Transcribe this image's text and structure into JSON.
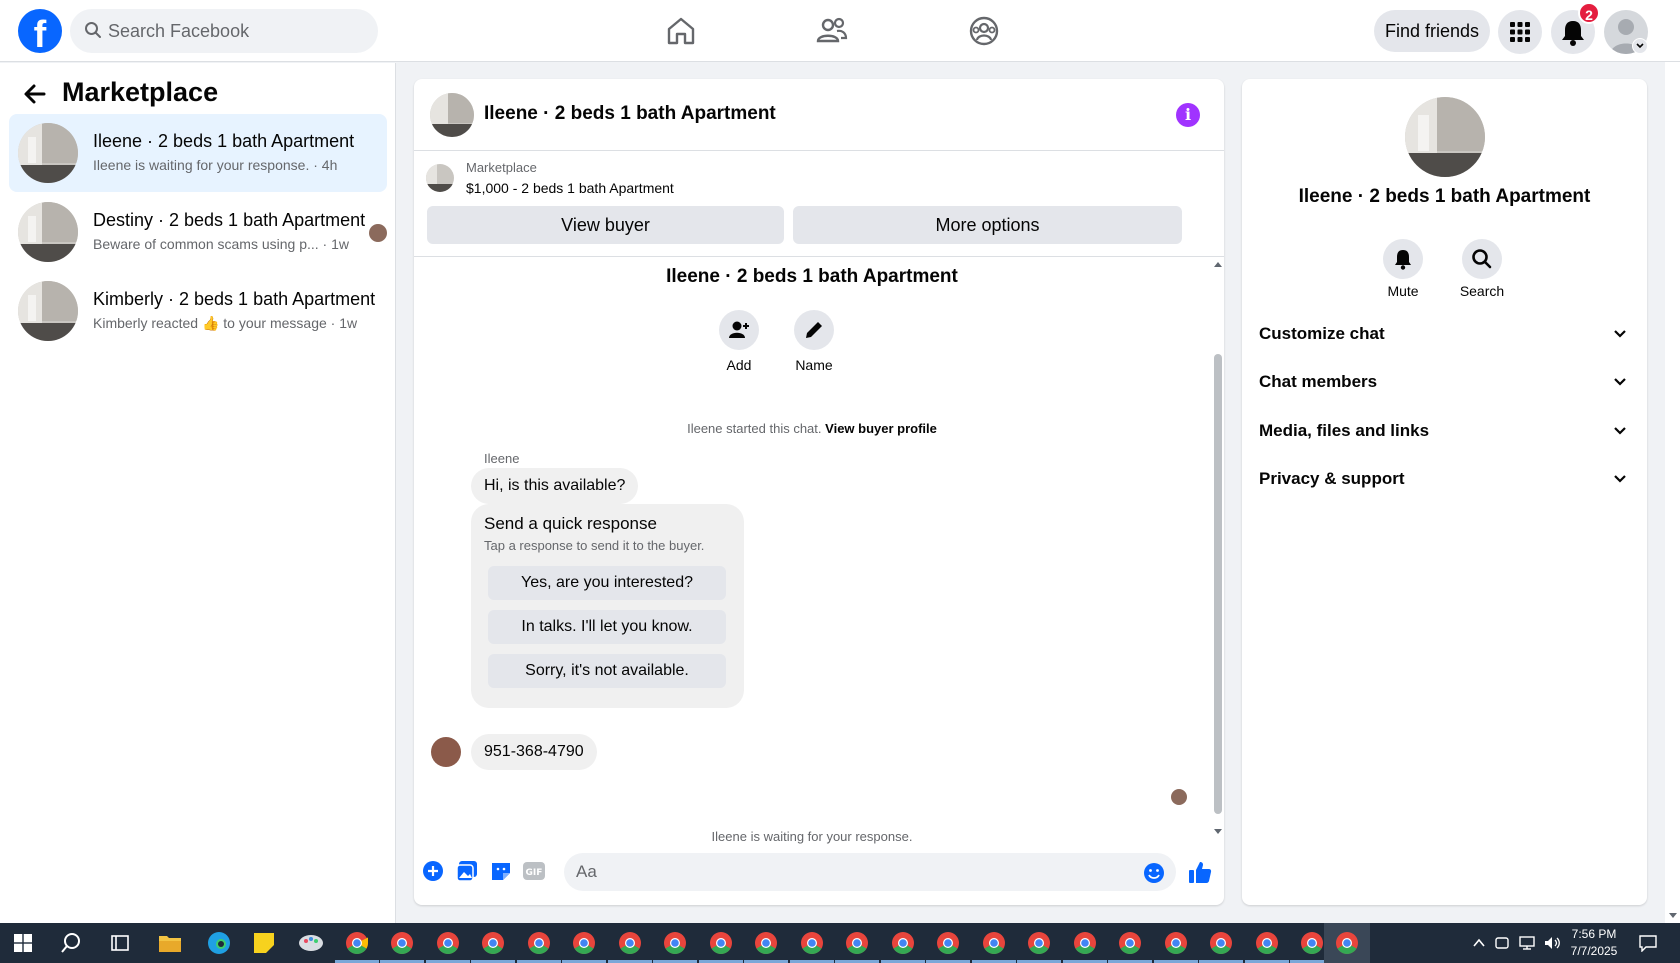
{
  "header": {
    "search_placeholder": "Search Facebook",
    "find_friends_label": "Find friends",
    "notification_count": "2"
  },
  "sidebar": {
    "title": "Marketplace",
    "conversations": [
      {
        "title": "Ileene · 2 beds 1 bath Apartment",
        "subtitle": "Ileene is waiting for your response. · 4h",
        "active": true
      },
      {
        "title": "Destiny · 2 beds 1 bath Apartment",
        "subtitle": "Beware of common scams using p... · 1w"
      },
      {
        "title": "Kimberly · 2 beds 1 bath Apartment",
        "subtitle_pre": "Kimberly reacted",
        "subtitle_emoji": "👍",
        "subtitle_post": "to your message · 1w"
      }
    ]
  },
  "chat": {
    "title": "Ileene · 2 beds 1 bath Apartment",
    "listing_category": "Marketplace",
    "listing_price": "$1,000 - 2 beds 1 bath Apartment",
    "view_buyer_label": "View buyer",
    "more_options_label": "More options",
    "conversation_title": "Ileene · 2 beds 1 bath Apartment",
    "add_label": "Add",
    "name_label": "Name",
    "started_text": "Ileene started this chat.",
    "view_profile_link": "View buyer profile",
    "sender_name": "Ileene",
    "first_message": "Hi, is this available?",
    "quick_title": "Send a quick response",
    "quick_subtitle": "Tap a response to send it to the buyer.",
    "quick_options": [
      "Yes, are you interested?",
      "In talks. I'll let you know.",
      "Sorry, it's not available."
    ],
    "phone_message": "951-368-4790",
    "waiting_text": "Ileene is waiting for your response.",
    "composer_placeholder": "Aa"
  },
  "right_panel": {
    "name": "Ileene · 2 beds 1 bath Apartment",
    "mute_label": "Mute",
    "search_label": "Search",
    "sections": [
      "Customize chat",
      "Chat members",
      "Media, files and links",
      "Privacy & support"
    ]
  },
  "taskbar": {
    "time": "7:56 PM",
    "date": "7/7/2025"
  },
  "colors": {
    "brand_blue": "#0866ff",
    "active_row": "#e7f3ff",
    "info_purple": "#a033ff",
    "badge_red": "#e41e3f",
    "taskbar": "#1f2b3a"
  }
}
